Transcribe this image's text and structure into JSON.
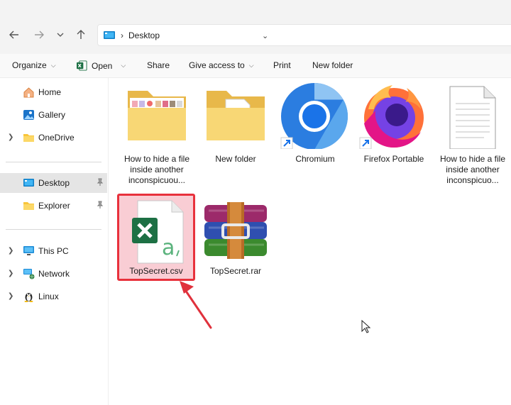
{
  "address": {
    "location": "Desktop"
  },
  "toolbar": {
    "organize": "Organize",
    "open": "Open",
    "share": "Share",
    "give_access": "Give access to",
    "print": "Print",
    "new_folder": "New folder"
  },
  "sidebar": {
    "items": [
      {
        "label": "Home",
        "icon": "home-icon"
      },
      {
        "label": "Gallery",
        "icon": "gallery-icon"
      },
      {
        "label": "OneDrive",
        "icon": "folder-icon"
      },
      {
        "label": "Desktop",
        "icon": "desktop-icon"
      },
      {
        "label": "Explorer",
        "icon": "folder-icon"
      },
      {
        "label": "This PC",
        "icon": "monitor-icon"
      },
      {
        "label": "Network",
        "icon": "network-icon"
      },
      {
        "label": "Linux",
        "icon": "linux-penguin-icon"
      }
    ]
  },
  "files": [
    {
      "name": "How to hide a file inside another inconspicuou...",
      "type": "folder-with-images"
    },
    {
      "name": "New folder",
      "type": "folder"
    },
    {
      "name": "Chromium",
      "type": "shortcut"
    },
    {
      "name": "Firefox Portable",
      "type": "shortcut"
    },
    {
      "name": "How to hide a file inside another inconspicuo...",
      "type": "text-document"
    },
    {
      "name": "TopSecret.csv",
      "type": "csv-file",
      "selected": true
    },
    {
      "name": "TopSecret.rar",
      "type": "rar-archive"
    }
  ],
  "colors": {
    "selection_highlight": "#f9cdd4",
    "selection_border": "#e8313c",
    "annotation_arrow": "#e0313c",
    "folder_yellow": "#f8d775",
    "excel_green": "#1d7044"
  }
}
